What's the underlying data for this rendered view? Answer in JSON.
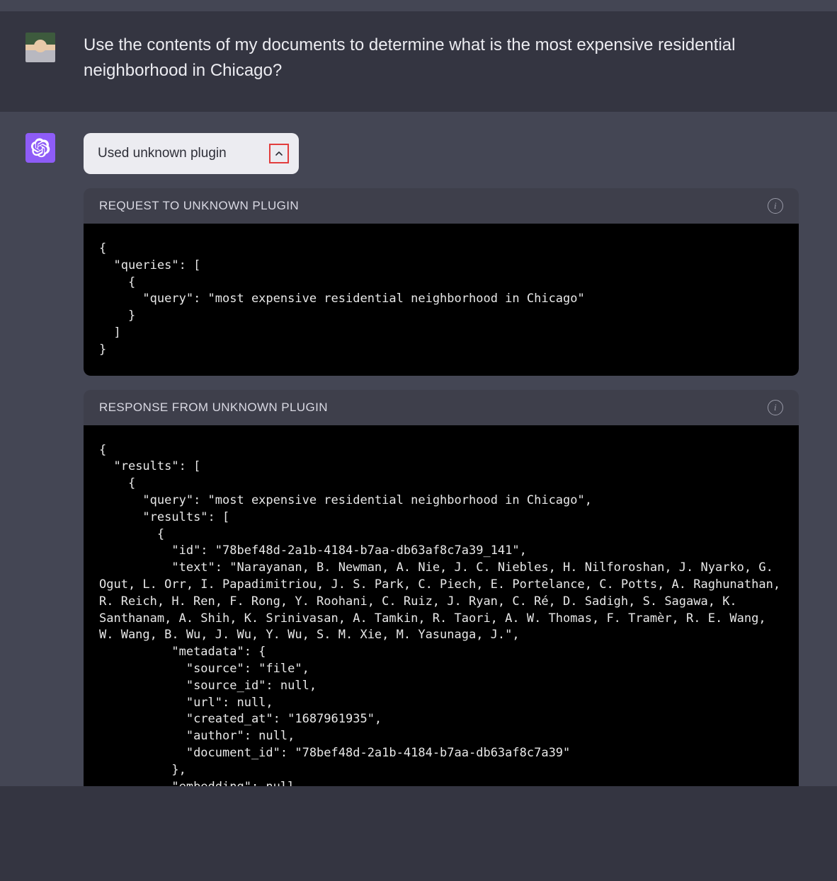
{
  "user_message": "Use the contents of my documents to determine what is the most expensive residential neighborhood in Chicago?",
  "plugin_pill": {
    "label": "Used unknown plugin"
  },
  "panels": {
    "request": {
      "title": "REQUEST TO UNKNOWN PLUGIN",
      "code": "{\n  \"queries\": [\n    {\n      \"query\": \"most expensive residential neighborhood in Chicago\"\n    }\n  ]\n}"
    },
    "response": {
      "title": "RESPONSE FROM UNKNOWN PLUGIN",
      "code": "{\n  \"results\": [\n    {\n      \"query\": \"most expensive residential neighborhood in Chicago\",\n      \"results\": [\n        {\n          \"id\": \"78bef48d-2a1b-4184-b7aa-db63af8c7a39_141\",\n          \"text\": \"Narayanan, B. Newman, A. Nie, J. C. Niebles, H. Nilforoshan, J. Nyarko, G. Ogut, L. Orr, I. Papadimitriou, J. S. Park, C. Piech, E. Portelance, C. Potts, A. Raghunathan, R. Reich, H. Ren, F. Rong, Y. Roohani, C. Ruiz, J. Ryan, C. Ré, D. Sadigh, S. Sagawa, K. Santhanam, A. Shih, K. Srinivasan, A. Tamkin, R. Taori, A. W. Thomas, F. Tramèr, R. E. Wang, W. Wang, B. Wu, J. Wu, Y. Wu, S. M. Xie, M. Yasunaga, J.\",\n          \"metadata\": {\n            \"source\": \"file\",\n            \"source_id\": null,\n            \"url\": null,\n            \"created_at\": \"1687961935\",\n            \"author\": null,\n            \"document_id\": \"78bef48d-2a1b-4184-b7aa-db63af8c7a39\"\n          },\n          \"embedding\": null"
    }
  }
}
